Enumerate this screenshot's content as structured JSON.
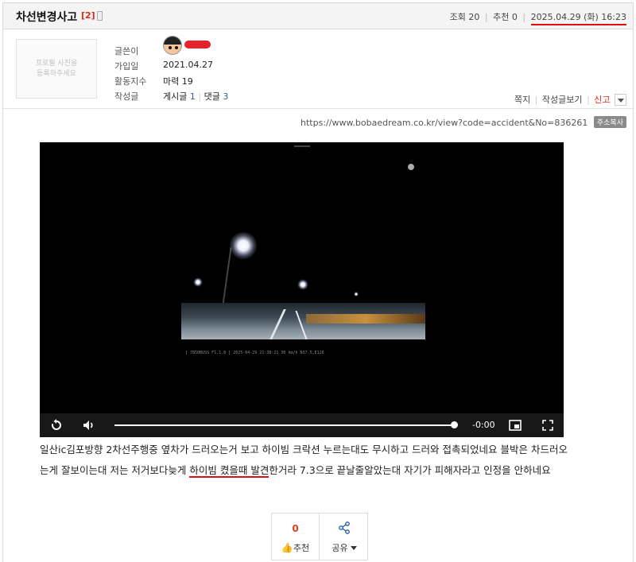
{
  "post": {
    "title": "차선변경사고",
    "comment_count": "[2]",
    "views_label": "조회",
    "views": "20",
    "recommend_label": "추천",
    "recommend_count": "0",
    "date": "2025.04.29 (화) 16:23"
  },
  "profile": {
    "photo_placeholder": "프로필 사진을\n등록하주세요",
    "author_label": "글쓴이",
    "joined_label": "가입일",
    "joined": "2021.04.27",
    "activity_label": "활동지수",
    "activity": "마력 19",
    "posts_label": "작성글",
    "posts_text": "게시글",
    "posts_count": "1",
    "comments_text": "댓글",
    "comments_count": "3"
  },
  "actions": {
    "message": "쪽지",
    "view_posts": "작성글보기",
    "report": "신고"
  },
  "url": {
    "address": "https://www.bobaedream.co.kr/view?code=accident&No=836261",
    "copy_label": "주소복사"
  },
  "video": {
    "time": "-0:00",
    "overlay": "[ 7850BUSS  F1.1.8 ]  2025-04-29 21:38:21  30 km/h  N37.5,E126",
    "progress": 1.0,
    "icons": [
      "replay-icon",
      "volume-icon",
      "pip-icon",
      "fullscreen-icon"
    ]
  },
  "body": {
    "line1": "일산ic김포방향 2차선주행중 옆차가 드러오는거 보고 하이빔 크락션 누르는대도 무시하고 드러와 접촉되었네요 블박은 차드러오",
    "line2_before": "는게 잘보이는대 저는 저거보다늦게 ",
    "line2_underlined": "하이빔 켰을때 발견",
    "line2_after": "한거라 7.3으로 끝날줄알았는대 자기가 피해자라고 인정을 안하네요"
  },
  "buttons": {
    "recommend_count": "0",
    "recommend_label": "추천",
    "share_label": "공유"
  },
  "colors": {
    "accent_red": "#e0281a",
    "link_blue": "#2a5db0"
  }
}
